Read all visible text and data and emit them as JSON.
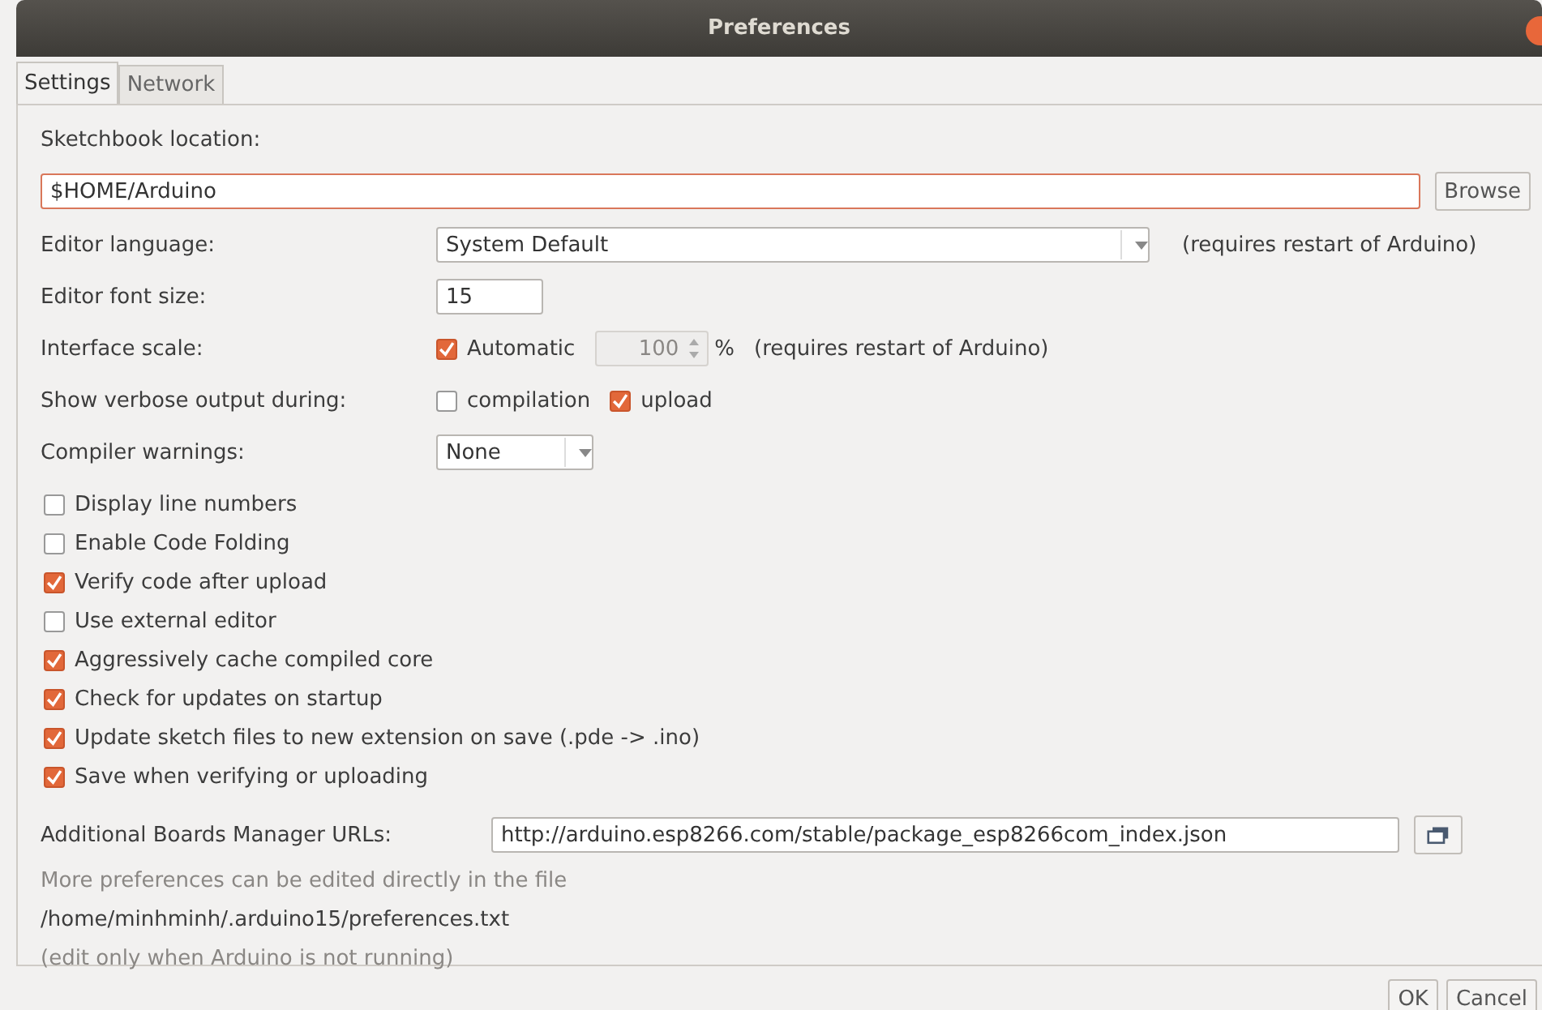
{
  "window": {
    "title": "Preferences"
  },
  "tabs": [
    {
      "label": "Settings",
      "selected": true
    },
    {
      "label": "Network",
      "selected": false
    }
  ],
  "sketchbook": {
    "label": "Sketchbook location:",
    "value": "$HOME/Arduino",
    "button": "Browse"
  },
  "editor_language": {
    "label": "Editor language:",
    "value": "System Default",
    "note": "(requires restart of Arduino)"
  },
  "editor_font_size": {
    "label": "Editor font size:",
    "value": "15"
  },
  "interface_scale": {
    "label": "Interface scale:",
    "automatic": {
      "label": "Automatic",
      "checked": true
    },
    "value": "100",
    "unit": "%",
    "note": "(requires restart of Arduino)"
  },
  "verbose_output": {
    "label": "Show verbose output during:",
    "options": [
      {
        "label": "compilation",
        "checked": false
      },
      {
        "label": "upload",
        "checked": true
      }
    ]
  },
  "compiler_warnings": {
    "label": "Compiler warnings:",
    "value": "None"
  },
  "options": [
    {
      "label": "Display line numbers",
      "checked": false
    },
    {
      "label": "Enable Code Folding",
      "checked": false
    },
    {
      "label": "Verify code after upload",
      "checked": true
    },
    {
      "label": "Use external editor",
      "checked": false
    },
    {
      "label": "Aggressively cache compiled core",
      "checked": true
    },
    {
      "label": "Check for updates on startup",
      "checked": true
    },
    {
      "label": "Update sketch files to new extension on save (.pde -> .ino)",
      "checked": true
    },
    {
      "label": "Save when verifying or uploading",
      "checked": true
    }
  ],
  "boards_manager": {
    "label": "Additional Boards Manager URLs:",
    "value": "http://arduino.esp8266.com/stable/package_esp8266com_index.json"
  },
  "footer_notes": [
    "More preferences can be edited directly in the file",
    "/home/minhminh/.arduino15/preferences.txt",
    "(edit only when Arduino is not running)"
  ],
  "buttons": [
    "OK",
    "Cancel"
  ]
}
